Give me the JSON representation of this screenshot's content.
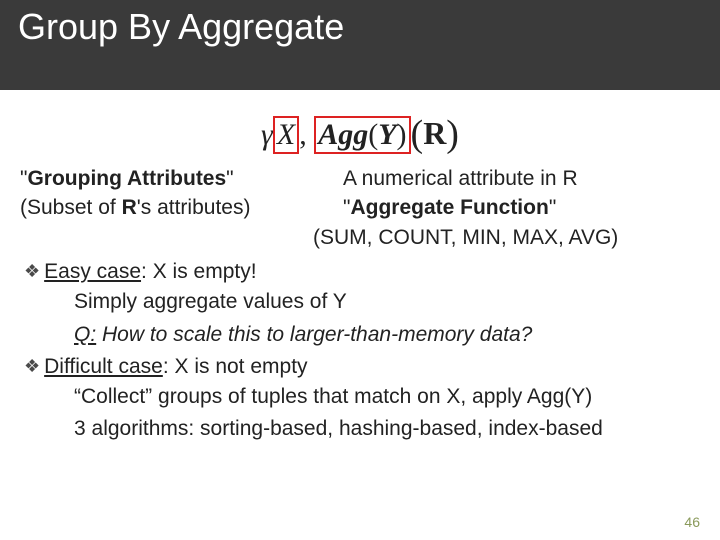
{
  "title": "Group By Aggregate",
  "formula": {
    "gamma": "γ",
    "x": "X",
    "comma": ", ",
    "agg": "Agg",
    "y": "Y",
    "lp": "(",
    "rp": ")",
    "R": "R"
  },
  "left": {
    "l1a": "\"",
    "l1b": "Grouping Attributes",
    "l1c": "\"",
    "l2a": "(Subset of ",
    "l2b": "R",
    "l2c": "'s attributes)"
  },
  "right": {
    "r1": "A numerical attribute in R",
    "r2a": "\"",
    "r2b": "Aggregate Function",
    "r2c": "\"",
    "r3": "(SUM, COUNT, MIN, MAX, AVG)"
  },
  "b1": {
    "pre": "Easy case",
    "post": ": X is empty!",
    "s1": "Simply aggregate values of Y",
    "s2a": "Q:",
    "s2b": " How to scale this to larger-than-memory data?"
  },
  "b2": {
    "pre": "Difficult case",
    "post": ": X is not empty",
    "s1": "“Collect” groups of tuples that match on X, apply Agg(Y)",
    "s2": "3 algorithms: sorting-based, hashing-based, index-based"
  },
  "pagenum": "46"
}
